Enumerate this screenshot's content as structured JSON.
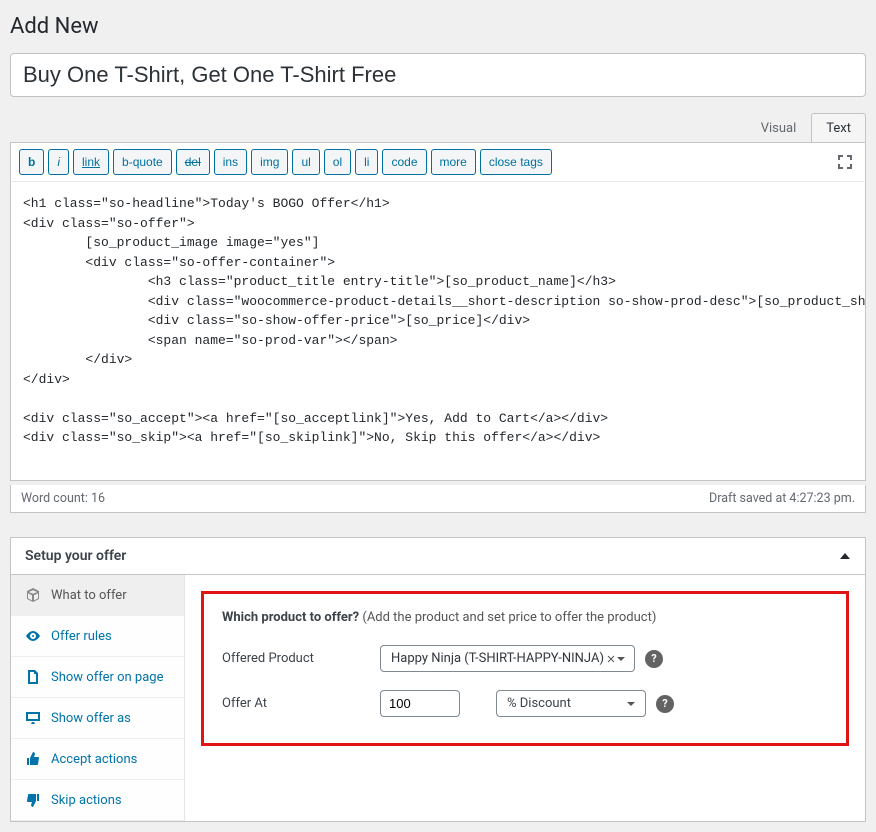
{
  "page": {
    "title": "Add New"
  },
  "post": {
    "title": "Buy One T-Shirt, Get One T-Shirt Free"
  },
  "editor": {
    "tabs": {
      "visual": "Visual",
      "text": "Text"
    },
    "buttons": {
      "b": "b",
      "i": "i",
      "link": "link",
      "bquote": "b-quote",
      "del": "del",
      "ins": "ins",
      "img": "img",
      "ul": "ul",
      "ol": "ol",
      "li": "li",
      "code": "code",
      "more": "more",
      "close": "close tags"
    },
    "content": "<h1 class=\"so-headline\">Today's BOGO Offer</h1>\n<div class=\"so-offer\">\n        [so_product_image image=\"yes\"]\n        <div class=\"so-offer-container\">\n                <h3 class=\"product_title entry-title\">[so_product_name]</h3>\n                <div class=\"woocommerce-product-details__short-description so-show-prod-desc\">[so_product_short_description]</div>\n                <div class=\"so-show-offer-price\">[so_price]</div>\n                <span name=\"so-prod-var\"></span>\n        </div>\n</div>\n\n<div class=\"so_accept\"><a href=\"[so_acceptlink]\">Yes, Add to Cart</a></div>\n<div class=\"so_skip\"><a href=\"[so_skiplink]\">No, Skip this offer</a></div>",
    "status": {
      "word_count": "Word count: 16",
      "draft_saved": "Draft saved at 4:27:23 pm."
    }
  },
  "setup": {
    "heading": "Setup your offer",
    "nav": {
      "what": "What to offer",
      "rules": "Offer rules",
      "page": "Show offer on page",
      "as": "Show offer as",
      "accept": "Accept actions",
      "skip": "Skip actions"
    },
    "pane": {
      "question_bold": "Which product to offer?",
      "question_rest": " (Add the product and set price to offer the product)",
      "offered_label": "Offered Product",
      "offered_value": "Happy Ninja (T-SHIRT-HAPPY-NINJA)",
      "offer_at_label": "Offer At",
      "offer_at_value": "100",
      "offer_at_unit": "% Discount"
    }
  }
}
